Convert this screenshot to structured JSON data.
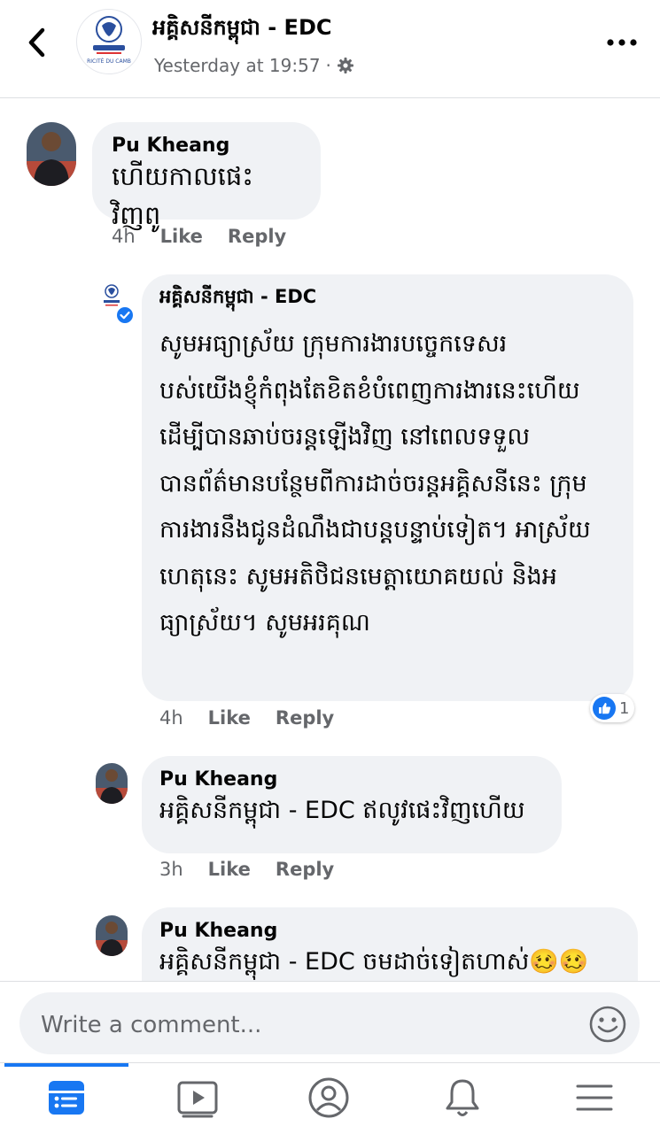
{
  "header": {
    "page_name": "អគ្គិសនីកម្ពុជា - EDC",
    "timestamp": "Yesterday at 19:57",
    "separator": "·",
    "logo_label": "RICITÉ DU CAMB"
  },
  "comments": [
    {
      "author": "Pu Kheang",
      "lines": [
        "ហើយកាលផេះវិញពូ"
      ],
      "time": "4h",
      "like_label": "Like",
      "reply_label": "Reply"
    },
    {
      "author": "អគ្គិសនីកម្ពុជា - EDC",
      "lines": [
        "សូមអធ្យាស្រ័យ ក្រុមការងារបច្ចេកទេសរ",
        "បស់យើងខ្ញុំកំពុងតែខិតខំបំពេញការងារនេះហើយ",
        "ដើម្បីបានឆាប់ចរន្តឡើងវិញ នៅពេលទទួល",
        "បានព័ត៌មានបន្ថែមពីការដាច់ចរន្តអគ្គិសនីនេះ ក្រុម",
        "ការងារនឹងជូនដំណឹងជាបន្តបន្ទាប់ទៀត។ អាស្រ័យ",
        "ហេតុនេះ សូមអតិថិជនមេត្តាយោគយល់ និងអ",
        "ធ្យាស្រ័យ។ សូមអរគុណ"
      ],
      "time": "4h",
      "like_label": "Like",
      "reply_label": "Reply",
      "reaction_count": "1"
    },
    {
      "author": "Pu Kheang",
      "lines": [
        "អគ្គិសនីកម្ពុជា - EDC ឥលូវផេះវិញហើយ"
      ],
      "time": "3h",
      "like_label": "Like",
      "reply_label": "Reply"
    },
    {
      "author": "Pu Kheang",
      "lines": [
        "អគ្គិសនីកម្ពុជា - EDC  ចមដាច់ទៀតហាស់"
      ],
      "emoji": "🥴🥴"
    }
  ],
  "composer": {
    "placeholder": "Write a comment..."
  },
  "icons": {
    "back": "chevron-left-icon",
    "settings": "gear-icon",
    "more": "more-dots-icon",
    "emoji": "smiley-icon",
    "verified": "verified-badge-icon",
    "like": "thumbs-up-icon",
    "tabs": [
      "news-feed-icon",
      "watch-video-icon",
      "profile-icon",
      "notifications-bell-icon",
      "menu-icon"
    ]
  },
  "colors": {
    "accent": "#1877f2",
    "bubble": "#f0f2f5",
    "secondary_text": "#65676b"
  }
}
